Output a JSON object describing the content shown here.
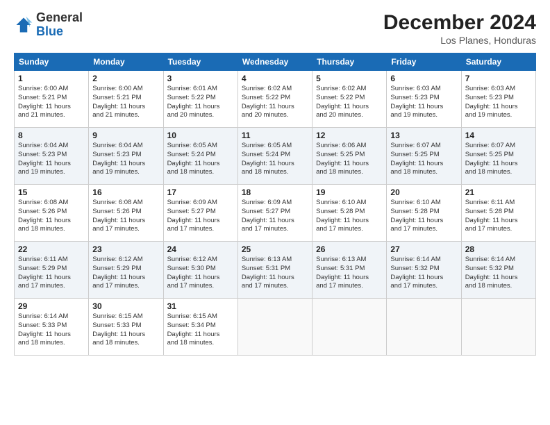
{
  "header": {
    "logo_general": "General",
    "logo_blue": "Blue",
    "month_title": "December 2024",
    "location": "Los Planes, Honduras"
  },
  "days_of_week": [
    "Sunday",
    "Monday",
    "Tuesday",
    "Wednesday",
    "Thursday",
    "Friday",
    "Saturday"
  ],
  "weeks": [
    [
      {
        "day": "1",
        "info": "Sunrise: 6:00 AM\nSunset: 5:21 PM\nDaylight: 11 hours\nand 21 minutes."
      },
      {
        "day": "2",
        "info": "Sunrise: 6:00 AM\nSunset: 5:21 PM\nDaylight: 11 hours\nand 21 minutes."
      },
      {
        "day": "3",
        "info": "Sunrise: 6:01 AM\nSunset: 5:22 PM\nDaylight: 11 hours\nand 20 minutes."
      },
      {
        "day": "4",
        "info": "Sunrise: 6:02 AM\nSunset: 5:22 PM\nDaylight: 11 hours\nand 20 minutes."
      },
      {
        "day": "5",
        "info": "Sunrise: 6:02 AM\nSunset: 5:22 PM\nDaylight: 11 hours\nand 20 minutes."
      },
      {
        "day": "6",
        "info": "Sunrise: 6:03 AM\nSunset: 5:23 PM\nDaylight: 11 hours\nand 19 minutes."
      },
      {
        "day": "7",
        "info": "Sunrise: 6:03 AM\nSunset: 5:23 PM\nDaylight: 11 hours\nand 19 minutes."
      }
    ],
    [
      {
        "day": "8",
        "info": "Sunrise: 6:04 AM\nSunset: 5:23 PM\nDaylight: 11 hours\nand 19 minutes."
      },
      {
        "day": "9",
        "info": "Sunrise: 6:04 AM\nSunset: 5:23 PM\nDaylight: 11 hours\nand 19 minutes."
      },
      {
        "day": "10",
        "info": "Sunrise: 6:05 AM\nSunset: 5:24 PM\nDaylight: 11 hours\nand 18 minutes."
      },
      {
        "day": "11",
        "info": "Sunrise: 6:05 AM\nSunset: 5:24 PM\nDaylight: 11 hours\nand 18 minutes."
      },
      {
        "day": "12",
        "info": "Sunrise: 6:06 AM\nSunset: 5:25 PM\nDaylight: 11 hours\nand 18 minutes."
      },
      {
        "day": "13",
        "info": "Sunrise: 6:07 AM\nSunset: 5:25 PM\nDaylight: 11 hours\nand 18 minutes."
      },
      {
        "day": "14",
        "info": "Sunrise: 6:07 AM\nSunset: 5:25 PM\nDaylight: 11 hours\nand 18 minutes."
      }
    ],
    [
      {
        "day": "15",
        "info": "Sunrise: 6:08 AM\nSunset: 5:26 PM\nDaylight: 11 hours\nand 18 minutes."
      },
      {
        "day": "16",
        "info": "Sunrise: 6:08 AM\nSunset: 5:26 PM\nDaylight: 11 hours\nand 17 minutes."
      },
      {
        "day": "17",
        "info": "Sunrise: 6:09 AM\nSunset: 5:27 PM\nDaylight: 11 hours\nand 17 minutes."
      },
      {
        "day": "18",
        "info": "Sunrise: 6:09 AM\nSunset: 5:27 PM\nDaylight: 11 hours\nand 17 minutes."
      },
      {
        "day": "19",
        "info": "Sunrise: 6:10 AM\nSunset: 5:28 PM\nDaylight: 11 hours\nand 17 minutes."
      },
      {
        "day": "20",
        "info": "Sunrise: 6:10 AM\nSunset: 5:28 PM\nDaylight: 11 hours\nand 17 minutes."
      },
      {
        "day": "21",
        "info": "Sunrise: 6:11 AM\nSunset: 5:28 PM\nDaylight: 11 hours\nand 17 minutes."
      }
    ],
    [
      {
        "day": "22",
        "info": "Sunrise: 6:11 AM\nSunset: 5:29 PM\nDaylight: 11 hours\nand 17 minutes."
      },
      {
        "day": "23",
        "info": "Sunrise: 6:12 AM\nSunset: 5:29 PM\nDaylight: 11 hours\nand 17 minutes."
      },
      {
        "day": "24",
        "info": "Sunrise: 6:12 AM\nSunset: 5:30 PM\nDaylight: 11 hours\nand 17 minutes."
      },
      {
        "day": "25",
        "info": "Sunrise: 6:13 AM\nSunset: 5:31 PM\nDaylight: 11 hours\nand 17 minutes."
      },
      {
        "day": "26",
        "info": "Sunrise: 6:13 AM\nSunset: 5:31 PM\nDaylight: 11 hours\nand 17 minutes."
      },
      {
        "day": "27",
        "info": "Sunrise: 6:14 AM\nSunset: 5:32 PM\nDaylight: 11 hours\nand 17 minutes."
      },
      {
        "day": "28",
        "info": "Sunrise: 6:14 AM\nSunset: 5:32 PM\nDaylight: 11 hours\nand 18 minutes."
      }
    ],
    [
      {
        "day": "29",
        "info": "Sunrise: 6:14 AM\nSunset: 5:33 PM\nDaylight: 11 hours\nand 18 minutes."
      },
      {
        "day": "30",
        "info": "Sunrise: 6:15 AM\nSunset: 5:33 PM\nDaylight: 11 hours\nand 18 minutes."
      },
      {
        "day": "31",
        "info": "Sunrise: 6:15 AM\nSunset: 5:34 PM\nDaylight: 11 hours\nand 18 minutes."
      },
      {
        "day": "",
        "info": ""
      },
      {
        "day": "",
        "info": ""
      },
      {
        "day": "",
        "info": ""
      },
      {
        "day": "",
        "info": ""
      }
    ]
  ]
}
